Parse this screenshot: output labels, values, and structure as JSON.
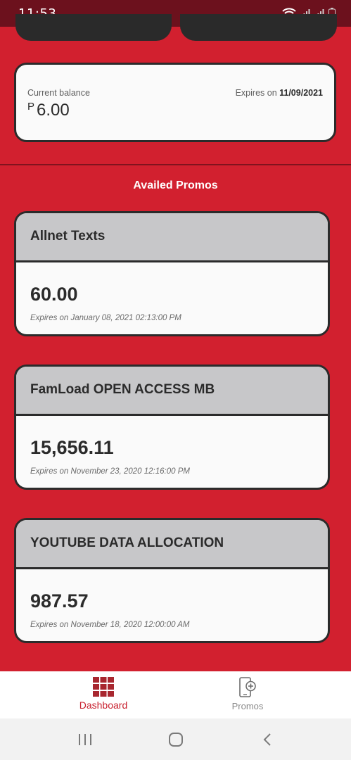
{
  "status_bar": {
    "time": "11:53",
    "icons": [
      "wifi-icon",
      "signal-icon",
      "signal-icon",
      "battery-icon"
    ]
  },
  "balance": {
    "label": "Current balance",
    "currency": "P",
    "amount": "6.00",
    "expiry_label": "Expires on ",
    "expiry_date": "11/09/2021"
  },
  "section": {
    "title": "Availed Promos"
  },
  "promos": [
    {
      "name": "Allnet Texts",
      "value": "60.00",
      "expiry": "Expires on January 08, 2021 02:13:00 PM"
    },
    {
      "name": "FamLoad OPEN ACCESS MB",
      "value": "15,656.11",
      "expiry": "Expires on November 23, 2020 12:16:00 PM"
    },
    {
      "name": "YOUTUBE DATA ALLOCATION",
      "value": "987.57",
      "expiry": "Expires on November 18, 2020 12:00:00 AM"
    }
  ],
  "bottom_nav": {
    "dashboard": "Dashboard",
    "promos": "Promos"
  },
  "colors": {
    "background": "#d2202f",
    "status_bar": "#6c111d",
    "accent": "#c8202e",
    "card_header": "#c7c7c9",
    "border": "#2b2b2b"
  }
}
